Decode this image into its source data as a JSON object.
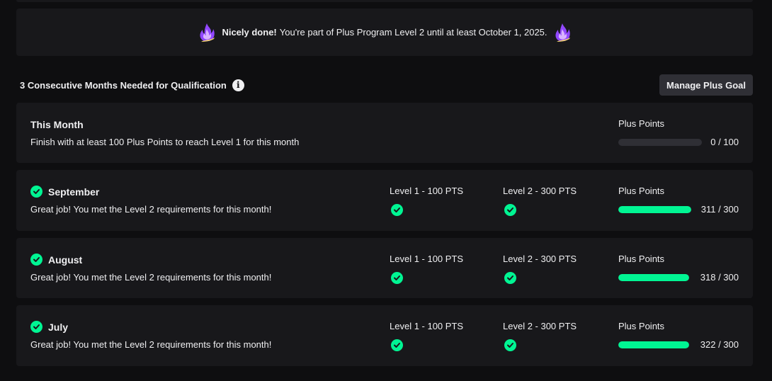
{
  "banner": {
    "bold": "Nicely done!",
    "text": "You're part of Plus Program Level 2 until at least October 1, 2025."
  },
  "qualification": {
    "title": "3 Consecutive Months Needed for Qualification",
    "info_icon": "info-icon",
    "manage_button": "Manage Plus Goal"
  },
  "this_month": {
    "title": "This Month",
    "description": "Finish with at least 100 Plus Points to reach Level 1 for this month",
    "points_label": "Plus Points",
    "points": "0 / 100",
    "progress": 0
  },
  "months": [
    {
      "name": "September",
      "description": "Great job! You met the Level 2 requirements for this month!",
      "level1_label": "Level 1 - 100 PTS",
      "level2_label": "Level 2 - 300 PTS",
      "points_label": "Plus Points",
      "points": "311 / 300",
      "progress": 1.0
    },
    {
      "name": "August",
      "description": "Great job! You met the Level 2 requirements for this month!",
      "level1_label": "Level 1 - 100 PTS",
      "level2_label": "Level 2 - 300 PTS",
      "points_label": "Plus Points",
      "points": "318 / 300",
      "progress": 1.0
    },
    {
      "name": "July",
      "description": "Great job! You met the Level 2 requirements for this month!",
      "level1_label": "Level 1 - 100 PTS",
      "level2_label": "Level 2 - 300 PTS",
      "points_label": "Plus Points",
      "points": "322 / 300",
      "progress": 1.0
    }
  ],
  "colors": {
    "accent_green": "#00f593",
    "card_bg": "#18181b",
    "page_bg": "#0e0e10",
    "flame_purple": "#9147ff"
  }
}
